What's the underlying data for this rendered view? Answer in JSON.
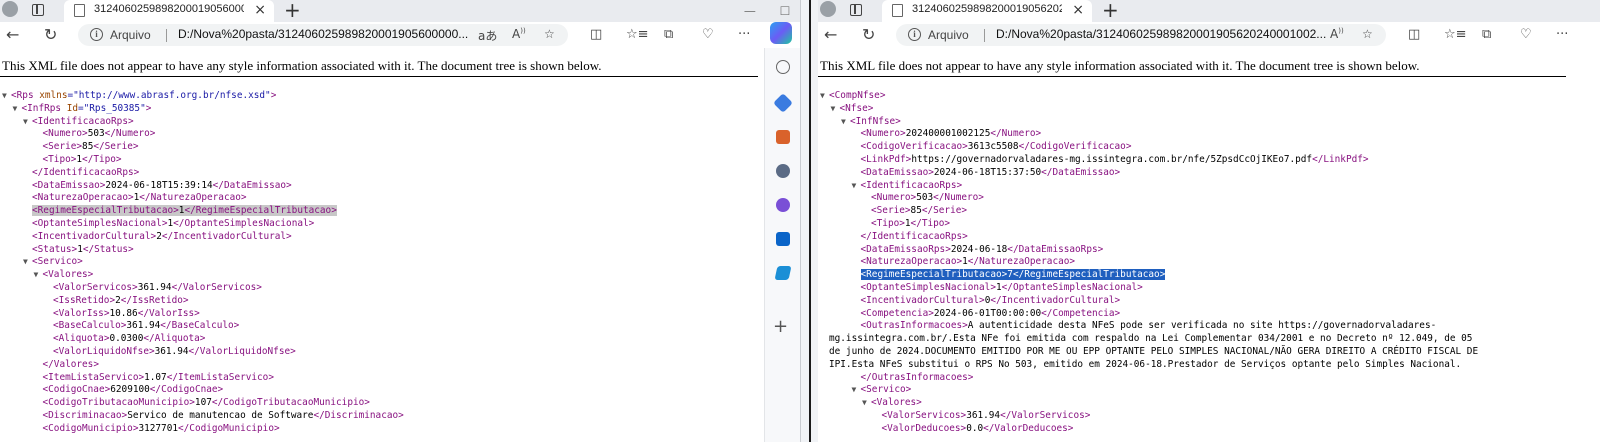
{
  "left": {
    "tab_title": "3124060259898200019056000000",
    "address_label": "Arquivo",
    "url": "D:/Nova%20pasta/312406025989820001905600000...",
    "read_aloud": "aあ",
    "xml_notice": "This XML file does not appear to have any style information associated with it. The document tree is shown below.",
    "lines": [
      {
        "d": 0,
        "t": "o",
        "n": "Rps",
        "a": [
          [
            "xmlns",
            "http://www.abrasf.org.br/nfse.xsd"
          ]
        ]
      },
      {
        "d": 1,
        "t": "o",
        "n": "InfRps",
        "a": [
          [
            "Id",
            "Rps_50385"
          ]
        ]
      },
      {
        "d": 2,
        "t": "o",
        "n": "IdentificacaoRps"
      },
      {
        "d": 3,
        "t": "l",
        "n": "Numero",
        "v": "503"
      },
      {
        "d": 3,
        "t": "l",
        "n": "Serie",
        "v": "85"
      },
      {
        "d": 3,
        "t": "l",
        "n": "Tipo",
        "v": "1"
      },
      {
        "d": 2,
        "t": "c",
        "n": "IdentificacaoRps"
      },
      {
        "d": 2,
        "t": "l",
        "n": "DataEmissao",
        "v": "2024-06-18T15:39:14"
      },
      {
        "d": 2,
        "t": "l",
        "n": "NaturezaOperacao",
        "v": "1"
      },
      {
        "d": 2,
        "t": "l",
        "n": "RegimeEspecialTributacao",
        "v": "1",
        "h": "gray"
      },
      {
        "d": 2,
        "t": "l",
        "n": "OptanteSimplesNacional",
        "v": "1"
      },
      {
        "d": 2,
        "t": "l",
        "n": "IncentivadorCultural",
        "v": "2"
      },
      {
        "d": 2,
        "t": "l",
        "n": "Status",
        "v": "1"
      },
      {
        "d": 2,
        "t": "o",
        "n": "Servico"
      },
      {
        "d": 3,
        "t": "o",
        "n": "Valores"
      },
      {
        "d": 4,
        "t": "l",
        "n": "ValorServicos",
        "v": "361.94"
      },
      {
        "d": 4,
        "t": "l",
        "n": "IssRetido",
        "v": "2"
      },
      {
        "d": 4,
        "t": "l",
        "n": "ValorIss",
        "v": "10.86"
      },
      {
        "d": 4,
        "t": "l",
        "n": "BaseCalculo",
        "v": "361.94"
      },
      {
        "d": 4,
        "t": "l",
        "n": "Aliquota",
        "v": "0.0300"
      },
      {
        "d": 4,
        "t": "l",
        "n": "ValorLiquidoNfse",
        "v": "361.94"
      },
      {
        "d": 3,
        "t": "c",
        "n": "Valores"
      },
      {
        "d": 3,
        "t": "l",
        "n": "ItemListaServico",
        "v": "1.07"
      },
      {
        "d": 3,
        "t": "l",
        "n": "CodigoCnae",
        "v": "6209100"
      },
      {
        "d": 3,
        "t": "l",
        "n": "CodigoTributacaoMunicipio",
        "v": "107"
      },
      {
        "d": 3,
        "t": "l",
        "n": "Discriminacao",
        "v": "Servico de manutencao de Software"
      },
      {
        "d": 3,
        "t": "l",
        "n": "CodigoMunicipio",
        "v": "3127701"
      }
    ]
  },
  "right": {
    "tab_title": "3124060259898200019056202400",
    "address_label": "Arquivo",
    "url": "D:/Nova%20pasta/312406025989820001905620240001002...",
    "xml_notice": "This XML file does not appear to have any style information associated with it. The document tree is shown below.",
    "lines": [
      {
        "d": 0,
        "t": "o",
        "n": "CompNfse"
      },
      {
        "d": 1,
        "t": "o",
        "n": "Nfse"
      },
      {
        "d": 2,
        "t": "o",
        "n": "InfNfse"
      },
      {
        "d": 3,
        "t": "l",
        "n": "Numero",
        "v": "202400001002125"
      },
      {
        "d": 3,
        "t": "l",
        "n": "CodigoVerificacao",
        "v": "3613c5508"
      },
      {
        "d": 3,
        "t": "l",
        "n": "LinkPdf",
        "v": "https://governadorvaladares-mg.issintegra.com.br/nfe/5ZpsdCcOjIKEo7.pdf"
      },
      {
        "d": 3,
        "t": "l",
        "n": "DataEmissao",
        "v": "2024-06-18T15:37:50"
      },
      {
        "d": 3,
        "t": "o",
        "n": "IdentificacaoRps"
      },
      {
        "d": 4,
        "t": "l",
        "n": "Numero",
        "v": "503"
      },
      {
        "d": 4,
        "t": "l",
        "n": "Serie",
        "v": "85"
      },
      {
        "d": 4,
        "t": "l",
        "n": "Tipo",
        "v": "1"
      },
      {
        "d": 3,
        "t": "c",
        "n": "IdentificacaoRps"
      },
      {
        "d": 3,
        "t": "l",
        "n": "DataEmissaoRps",
        "v": "2024-06-18"
      },
      {
        "d": 3,
        "t": "l",
        "n": "NaturezaOperacao",
        "v": "1"
      },
      {
        "d": 3,
        "t": "l",
        "n": "RegimeEspecialTributacao",
        "v": "7",
        "h": "blue"
      },
      {
        "d": 3,
        "t": "l",
        "n": "OptanteSimplesNacional",
        "v": "1"
      },
      {
        "d": 3,
        "t": "l",
        "n": "IncentivadorCultural",
        "v": "0"
      },
      {
        "d": 3,
        "t": "l",
        "n": "Competencia",
        "v": "2024-06-01T00:00:00"
      },
      {
        "d": 3,
        "t": "s",
        "n": "OutrasInformacoes",
        "v": "A autenticidade desta NFeS pode ser verificada no site https://governadorvaladares-"
      },
      {
        "d": 3,
        "t": "x",
        "v": "mg.issintegra.com.br/.Esta NFe foi emitida com respaldo na Lei Complementar 034/2001 e no Decreto nº 12.049, de 05"
      },
      {
        "d": 3,
        "t": "x",
        "v": "de junho de 2024.DOCUMENTO EMITIDO POR ME OU EPP OPTANTE PELO SIMPLES NACIONAL/NÃO GERA DIREITO A CRÉDITO FISCAL DE"
      },
      {
        "d": 3,
        "t": "x",
        "v": "IPI.Esta NFeS substitui o RPS No 503, emitido em 2024-06-18.Prestador de Serviços optante pelo Simples Nacional."
      },
      {
        "d": 3,
        "t": "c",
        "n": "OutrasInformacoes"
      },
      {
        "d": 3,
        "t": "o",
        "n": "Servico"
      },
      {
        "d": 4,
        "t": "o",
        "n": "Valores"
      },
      {
        "d": 5,
        "t": "l",
        "n": "ValorServicos",
        "v": "361.94"
      },
      {
        "d": 5,
        "t": "l",
        "n": "ValorDeducoes",
        "v": "0.0"
      }
    ]
  },
  "icons": {
    "back": "back-arrow-icon",
    "refresh": "refresh-icon",
    "favorites": "star-icon",
    "split": "split-screen-icon",
    "collections": "collections-icon",
    "more": "more-icon"
  }
}
